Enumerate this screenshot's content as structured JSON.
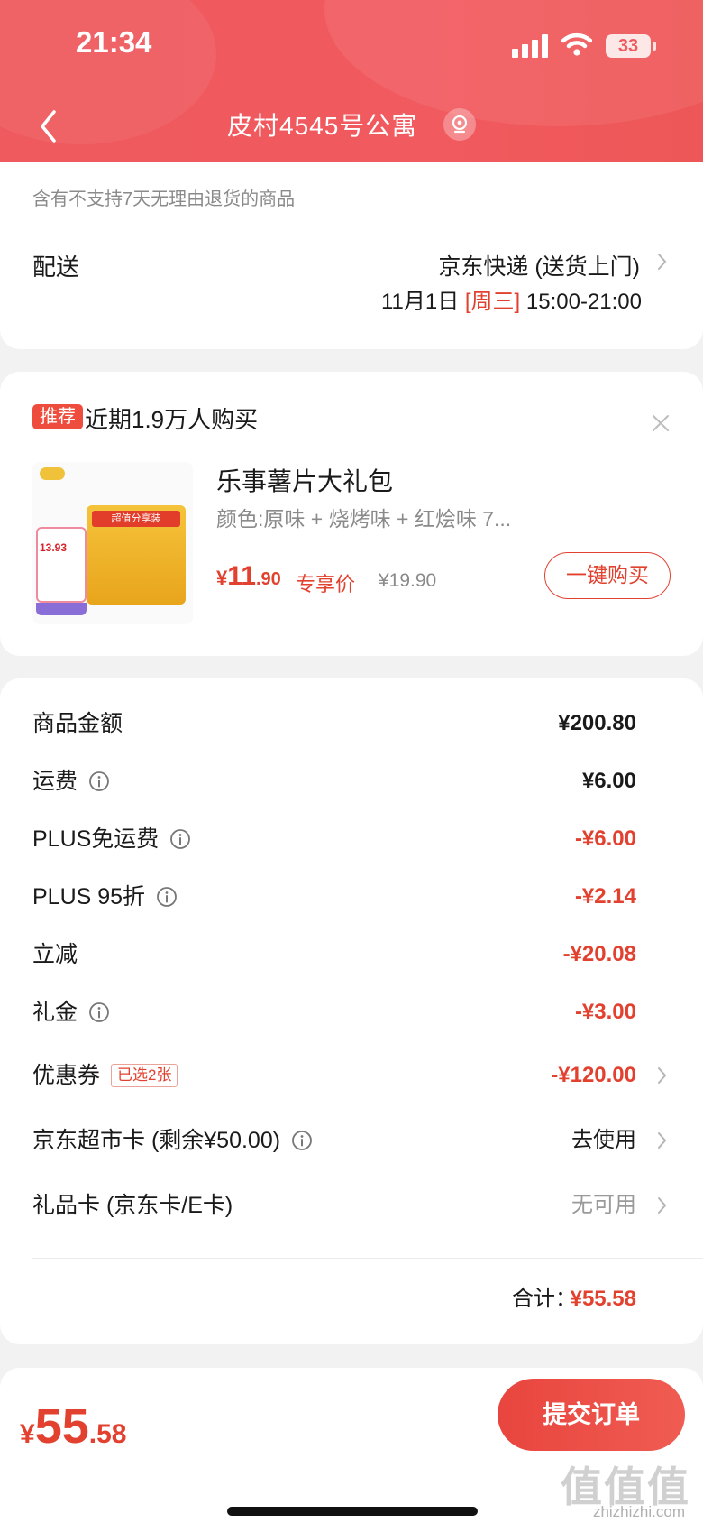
{
  "status_bar": {
    "time": "21:34",
    "battery": "33"
  },
  "header": {
    "address": "皮村4545号公寓"
  },
  "delivery": {
    "notice": "含有不支持7天无理由退货的商品",
    "label": "配送",
    "method": "京东快递 (送货上门)",
    "date": "11月1日",
    "day": "[周三]",
    "time_window": "15:00-21:00"
  },
  "recommend": {
    "badge": "推荐",
    "text": "近期1.9万人购买",
    "product": {
      "name": "乐事薯片大礼包",
      "spec": "颜色:原味 + 烧烤味 + 红烩味 7...",
      "price_currency": "¥",
      "price_int": "11",
      "price_dec": ".90",
      "price_tag": "专享价",
      "original_price": "¥19.90",
      "buy_label": "一键购买",
      "image_price": "13.93",
      "image_bag_title": "超值分享装"
    }
  },
  "summary": {
    "rows": [
      {
        "label": "商品金额",
        "value": "¥200.80"
      },
      {
        "label": "运费",
        "value": "¥6.00"
      },
      {
        "label": "PLUS免运费",
        "value": "-¥6.00"
      },
      {
        "label": "PLUS 95折",
        "value": "-¥2.14"
      },
      {
        "label": "立减",
        "value": "-¥20.08"
      },
      {
        "label": "礼金",
        "value": "-¥3.00"
      },
      {
        "label": "优惠券",
        "tag": "已选2张",
        "value": "-¥120.00"
      },
      {
        "label": "京东超市卡 (剩余¥50.00)",
        "value": "去使用"
      },
      {
        "label": "礼品卡 (京东卡/E卡)",
        "value": "无可用"
      }
    ],
    "total_label": "合计：",
    "total_value": "¥55.58"
  },
  "bottom": {
    "currency": "¥",
    "price_int": "55",
    "price_dec": ".58",
    "submit_label": "提交订单",
    "watermark": "值值值",
    "watermark_sub": "zhizhizhi.com"
  },
  "colors": {
    "accent": "#e2412f",
    "header": "#ef5a5e"
  }
}
